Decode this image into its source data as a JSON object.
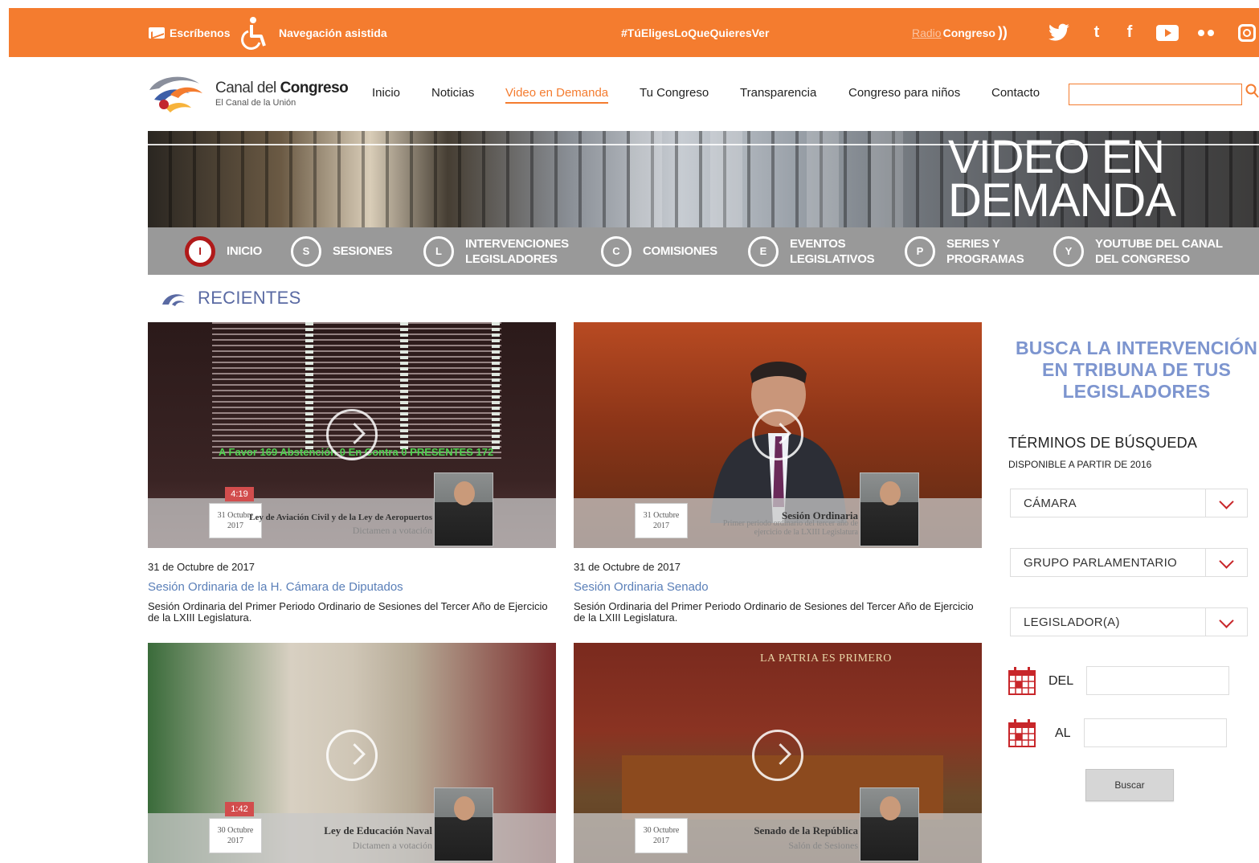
{
  "topbar": {
    "escribenos": "Escríbenos",
    "navegacion": "Navegación asistida",
    "hashtag": "#TúEligesLoQueQuieresVer",
    "radio_light": "Radio",
    "radio_bold": "Congreso",
    "radio_waves": "))",
    "social_icons": [
      "twitter-icon",
      "tumblr-icon",
      "facebook-icon",
      "youtube-icon",
      "flickr-icon",
      "instagram-icon"
    ],
    "tumblr_glyph": "t",
    "facebook_glyph": "f",
    "twitter_glyph": "🐦"
  },
  "logo": {
    "title_light": "Canal del ",
    "title_bold": "Congreso",
    "subtitle": "El Canal de la Unión"
  },
  "nav": {
    "items": [
      "Inicio",
      "Noticias",
      "Video en Demanda",
      "Tu Congreso",
      "Transparencia",
      "Congreso para niños",
      "Contacto"
    ],
    "active": "Video en Demanda"
  },
  "search": {
    "value": "",
    "placeholder": ""
  },
  "banner": {
    "title": "VIDEO EN\nDEMANDA"
  },
  "section_menu": [
    {
      "icon_letter": "I",
      "label": "INICIO",
      "active": true
    },
    {
      "icon_letter": "S",
      "label": "SESIONES",
      "active": false
    },
    {
      "icon_letter": "L",
      "label": "INTERVENCIONES\nLEGISLADORES",
      "active": false
    },
    {
      "icon_letter": "C",
      "label": "COMISIONES",
      "active": false
    },
    {
      "icon_letter": "E",
      "label": "EVENTOS\nLEGISLATIVOS",
      "active": false
    },
    {
      "icon_letter": "P",
      "label": "SERIES Y\nPROGRAMAS",
      "active": false
    },
    {
      "icon_letter": "Y",
      "label": "YOUTUBE DEL CANAL\nDEL CONGRESO",
      "active": false
    }
  ],
  "recientes": {
    "title": "RECIENTES"
  },
  "videos": [
    {
      "date": "31 de Octubre de 2017",
      "title": "Sesión Ordinaria de la H. Cámara de Diputados",
      "description": "Sesión Ordinaria del Primer Periodo Ordinario de Sesiones del Tercer Año de Ejercicio de la LXIII Legislatura.",
      "thumb": {
        "duration": "4:19",
        "date_box": "31 Octubre\n2017",
        "caption": "Ley de Aviación Civil y de la Ley de Aeropuertos",
        "caption2": "Dictamen a votación",
        "tally": "A Favor  169  Abstención 0   En Contra 0   PRESENTES 172"
      }
    },
    {
      "date": "31 de Octubre de 2017",
      "title": "Sesión Ordinaria Senado",
      "description": "Sesión Ordinaria del Primer Periodo Ordinario de Sesiones del Tercer Año de Ejercicio de la LXIII Legislatura.",
      "thumb": {
        "duration": "",
        "date_box": "31 Octubre\n2017",
        "caption": "Sesión Ordinaria",
        "caption2": "Primer periodo ordinario del tercer año de ejercicio de la LXIII Legislatura"
      }
    },
    {
      "date": "",
      "title": "",
      "description": "",
      "thumb": {
        "duration": "1:42",
        "date_box": "30 Octubre\n2017",
        "caption": "Ley de Educación Naval",
        "caption2": "Dictamen a votación"
      }
    },
    {
      "date": "",
      "title": "",
      "description": "",
      "thumb": {
        "duration": "",
        "date_box": "30 Octubre\n2017",
        "caption": "Senado de la República",
        "caption2": "Salón de Sesiones",
        "motto": "LA PATRIA ES PRIMERO"
      }
    }
  ],
  "sidebar": {
    "title": "BUSCA LA INTERVENCIÓN\nEN TRIBUNA DE TUS\nLEGISLADORES",
    "terms_title": "TÉRMINOS DE BÚSQUEDA",
    "terms_sub": "DISPONIBLE A PARTIR DE 2016",
    "selects": [
      "CÁMARA",
      "GRUPO PARLAMENTARIO",
      "LEGISLADOR(A)"
    ],
    "del_label": "DEL",
    "al_label": "AL",
    "del_value": "",
    "al_value": "",
    "button": "Buscar"
  },
  "colors": {
    "brand_orange": "#f47c2f",
    "section_gray": "#999999",
    "title_blue": "#7d95cf",
    "link_blue": "#5a7fb8",
    "chevron_red": "#c8262a",
    "active_red": "#b01a1a"
  }
}
